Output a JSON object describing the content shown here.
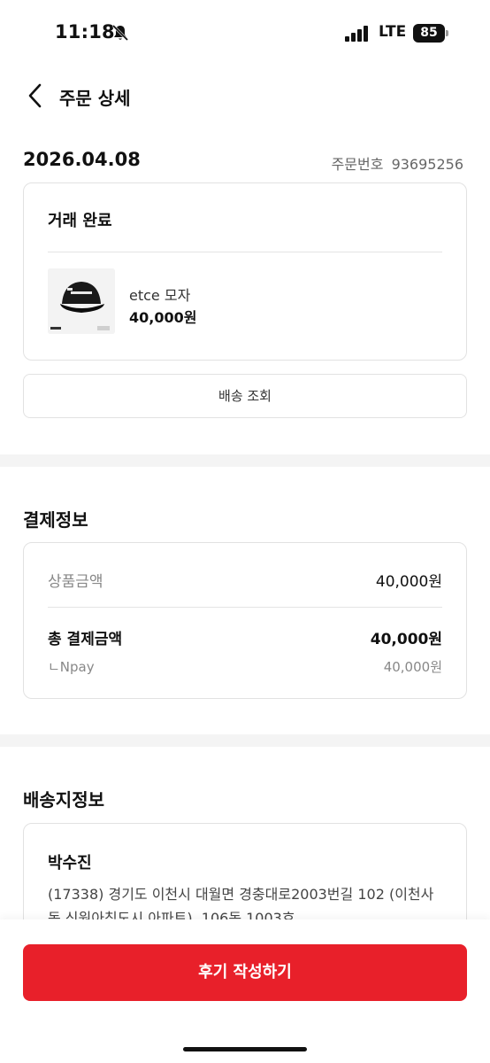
{
  "status_bar": {
    "time": "11:18",
    "network": "LTE",
    "battery": "85",
    "icons": [
      "bell-muted-icon",
      "signal-icon"
    ]
  },
  "header": {
    "title": "주문 상세",
    "back_icon": "chevron-left-icon"
  },
  "order": {
    "date": "2026.04.08",
    "number_label": "주문번호",
    "number": "93695256",
    "status": "거래 완료",
    "product": {
      "name": "etce 모자",
      "price": "40,000원",
      "thumbnail": "black-cap-image"
    },
    "track_button": "배송 조회"
  },
  "payment": {
    "title": "결제정보",
    "product_amount_label": "상품금액",
    "product_amount": "40,000원",
    "total_label": "총 결제금액",
    "total": "40,000원",
    "method_label": "ㄴNpay",
    "method_amount": "40,000원"
  },
  "shipping": {
    "title": "배송지정보",
    "recipient": "박수진",
    "address": "(17338) 경기도 이천시 대월면 경충대로2003번길 102 (이천사동 신원아침도시 아파트), 106동 1003호"
  },
  "actions": {
    "review_button": "후기 작성하기"
  },
  "colors": {
    "accent": "#e8202a",
    "section_gap": "#f4f4f4",
    "border": "#e2e2e2"
  }
}
